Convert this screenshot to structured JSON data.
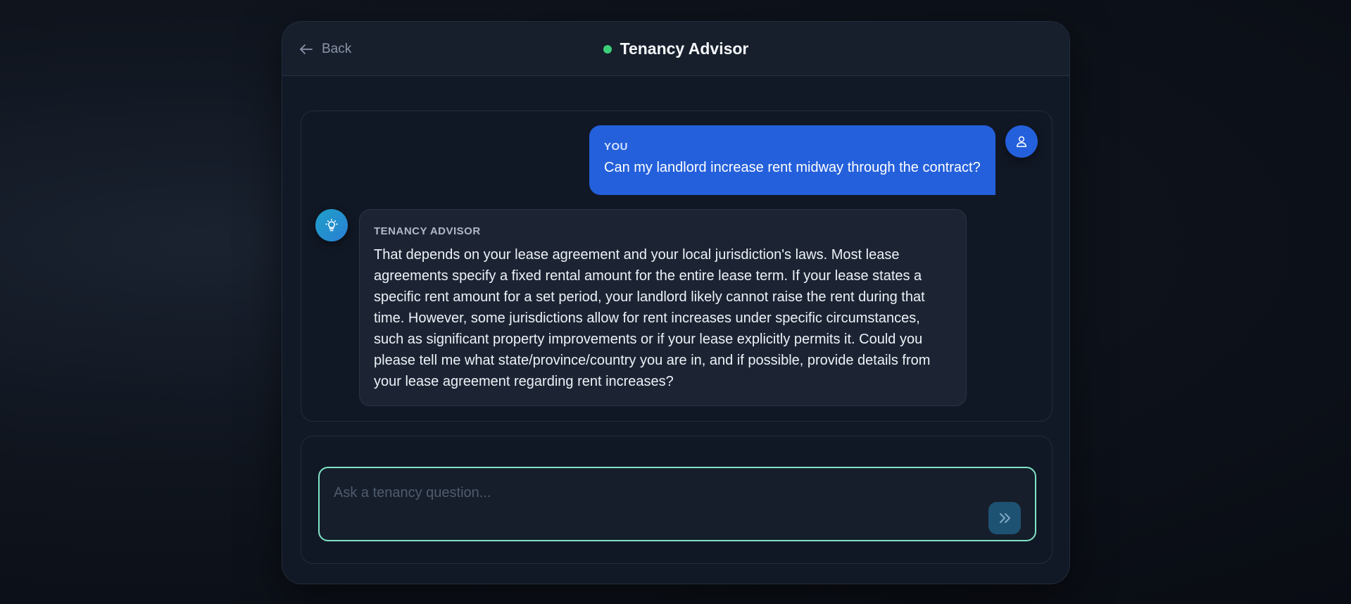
{
  "header": {
    "back_label": "Back",
    "title": "Tenancy Advisor",
    "status_color": "#3ccf7a"
  },
  "messages": [
    {
      "role": "user",
      "sender_label": "YOU",
      "text": "Can my landlord increase rent midway through the contract?",
      "avatar_icon": "user-icon",
      "bubble_color": "#2460db"
    },
    {
      "role": "assistant",
      "sender_label": "TENANCY ADVISOR",
      "text": "That depends on your lease agreement and your local jurisdiction's laws.  Most lease agreements specify a fixed rental amount for the entire lease term.  If your lease states a specific rent amount for a set period, your landlord likely cannot raise the rent during that time. However, some jurisdictions allow for rent increases under specific circumstances, such as significant property improvements or if your lease explicitly permits it.  Could you please tell me what state/province/country you are in, and if possible, provide details from your lease agreement regarding rent increases?",
      "avatar_icon": "lightbulb-icon"
    }
  ],
  "composer": {
    "placeholder": "Ask a tenancy question...",
    "value": "",
    "send_icon": "chevrons-right-icon",
    "focus_color": "#7fe3c6"
  }
}
